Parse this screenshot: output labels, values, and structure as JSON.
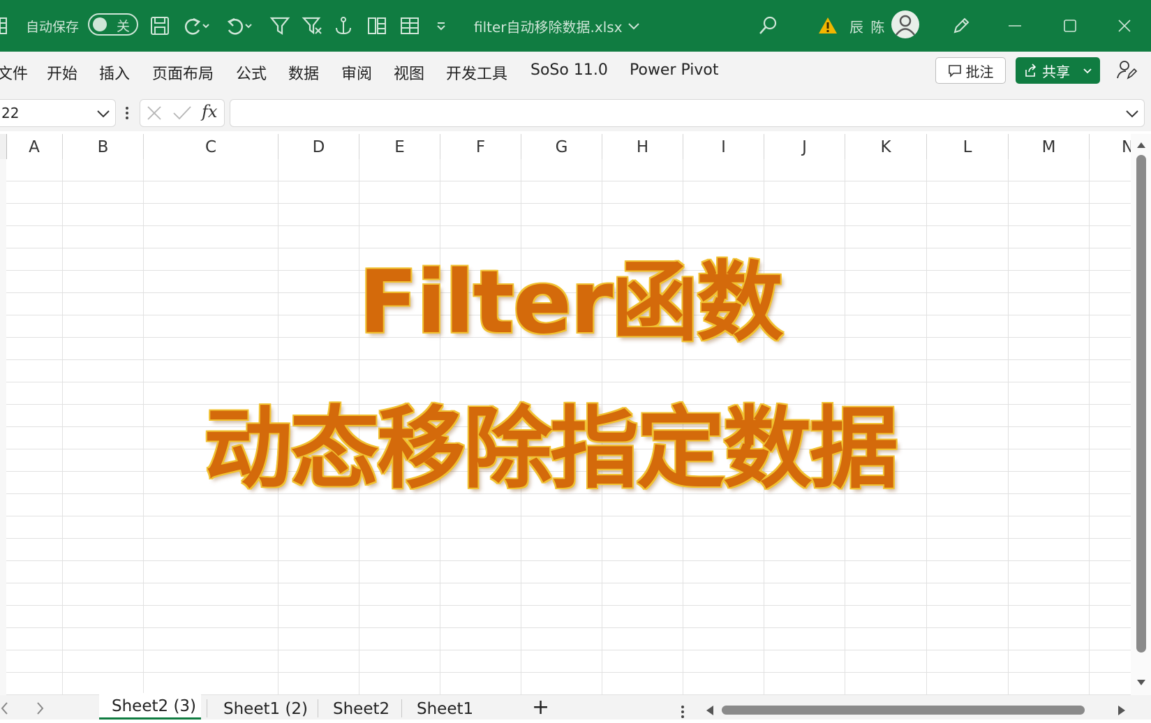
{
  "titlebar": {
    "autosave_label": "自动保存",
    "autosave_toggle": "关",
    "filename": "filter自动移除数据.xlsx",
    "user_name": "辰 陈",
    "colors": {
      "bg": "#107c41",
      "fg": "#cfe6d8"
    }
  },
  "menu": {
    "items": [
      "文件",
      "开始",
      "插入",
      "页面布局",
      "公式",
      "数据",
      "审阅",
      "视图",
      "开发工具",
      "SoSo 11.0",
      "Power Pivot"
    ],
    "comment_button": "批注",
    "share_button": "共享"
  },
  "formula_bar": {
    "name_box": "22",
    "fx_label": "fx",
    "formula": ""
  },
  "columns": [
    "A",
    "B",
    "C",
    "D",
    "E",
    "F",
    "G",
    "H",
    "I",
    "J",
    "K",
    "L",
    "M",
    "N"
  ],
  "overlay": {
    "line1": "Filter函数",
    "line2": "动态移除指定数据",
    "color": "#d46a0b",
    "outline": "#f1c232"
  },
  "sheets": {
    "tabs": [
      "Sheet2 (3)",
      "Sheet1 (2)",
      "Sheet2",
      "Sheet1"
    ],
    "active": "Sheet2 (3)",
    "add_label": "+"
  },
  "icons": [
    "save-icon",
    "redo-icon",
    "undo-icon",
    "filter-icon",
    "clear-filter-icon",
    "anchor-icon",
    "freeze-icon",
    "layout-icon",
    "customize-icon",
    "search-icon",
    "warning-icon",
    "pen-icon",
    "minimize-icon",
    "maximize-icon",
    "close-icon"
  ]
}
